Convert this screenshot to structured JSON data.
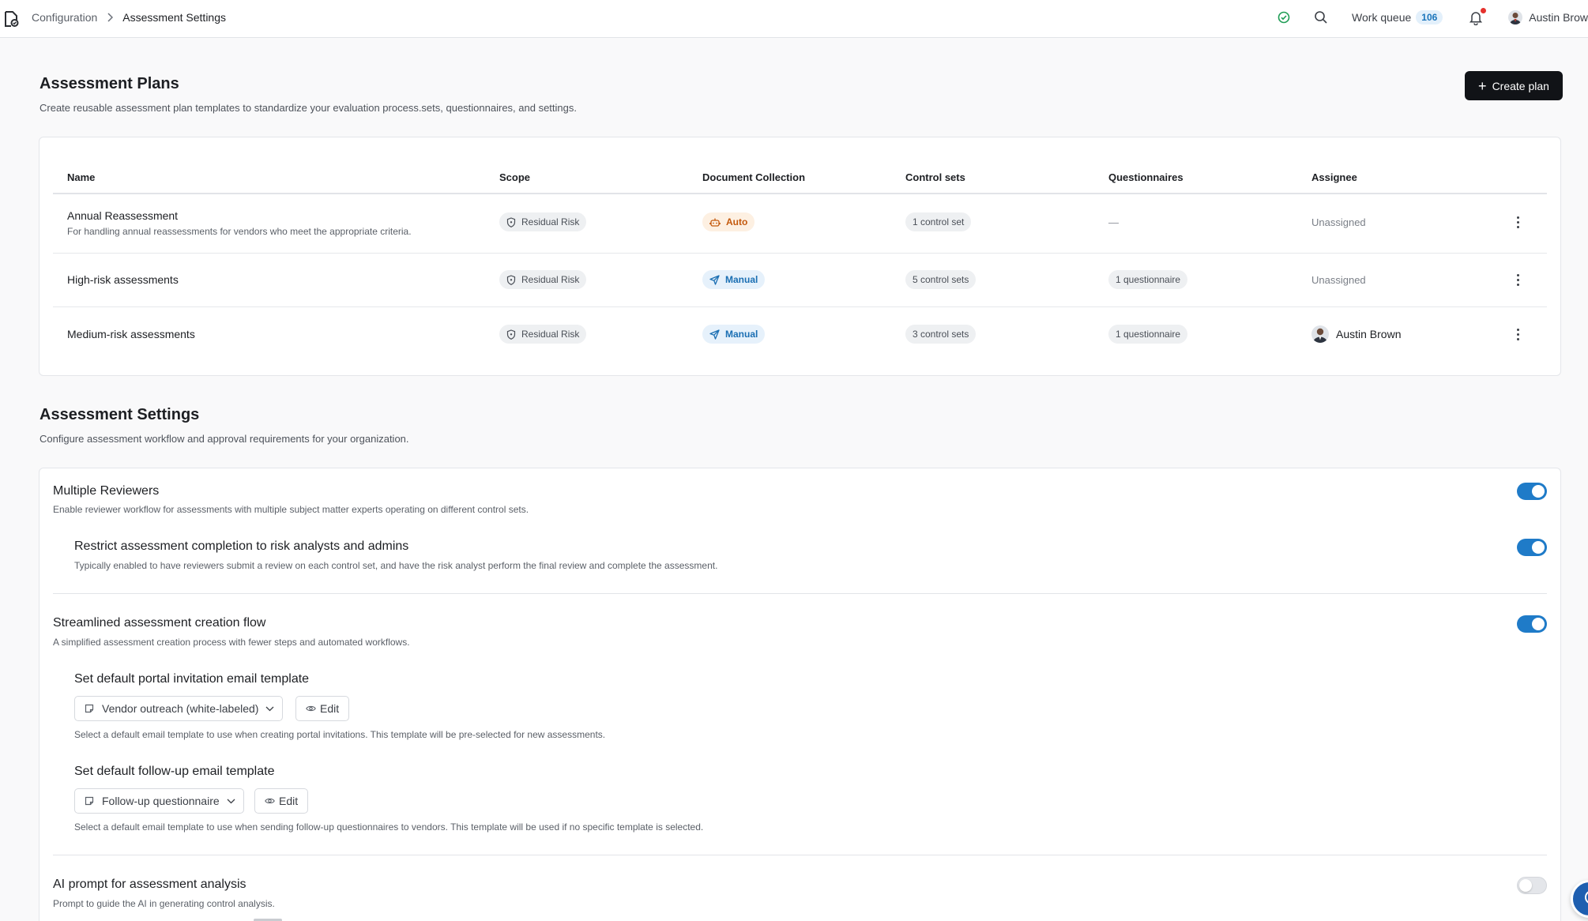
{
  "topbar": {
    "breadcrumb": [
      "Configuration",
      "Assessment Settings"
    ],
    "work_queue_label": "Work queue",
    "work_queue_count": "106",
    "user_name": "Austin Brow",
    "status_color": "#1f9d55",
    "notification_dot_color": "#e5322d"
  },
  "plans": {
    "title": "Assessment Plans",
    "description": "Create reusable assessment plan templates to standardize your evaluation process.sets, questionnaires, and settings.",
    "create_button": "Create plan",
    "columns": [
      "Name",
      "Scope",
      "Document Collection",
      "Control sets",
      "Questionnaires",
      "Assignee"
    ],
    "rows": [
      {
        "name": "Annual Reassessment",
        "description": "For handling annual reassessments for vendors who meet the appropriate criteria.",
        "scope": "Residual Risk",
        "collection": "Auto",
        "collection_icon": "robot-icon",
        "control_sets": "1 control set",
        "questionnaires": "—",
        "assignee": "Unassigned"
      },
      {
        "name": "High-risk assessments",
        "description": "",
        "scope": "Residual Risk",
        "collection": "Manual",
        "collection_icon": "send-icon",
        "control_sets": "5 control sets",
        "questionnaires": "1 questionnaire",
        "assignee": "Unassigned"
      },
      {
        "name": "Medium-risk assessments",
        "description": "",
        "scope": "Residual Risk",
        "collection": "Manual",
        "collection_icon": "send-icon",
        "control_sets": "3 control sets",
        "questionnaires": "1 questionnaire",
        "assignee": "Austin Brown"
      }
    ]
  },
  "settings": {
    "title": "Assessment Settings",
    "description": "Configure assessment workflow and approval requirements for your organization.",
    "multiple_reviewers": {
      "title": "Multiple Reviewers",
      "description": "Enable reviewer workflow for assessments with multiple subject matter experts operating on different control sets.",
      "enabled": true
    },
    "restrict_completion": {
      "title": "Restrict assessment completion to risk analysts and admins",
      "description": "Typically enabled to have reviewers submit a review on each control set, and have the risk analyst perform the final review and complete the assessment.",
      "enabled": true
    },
    "streamlined": {
      "title": "Streamlined assessment creation flow",
      "description": "A simplified assessment creation process with fewer steps and automated workflows.",
      "enabled": true
    },
    "portal_template": {
      "title": "Set default portal invitation email template",
      "selected": "Vendor outreach (white-labeled)",
      "edit_label": "Edit",
      "help": "Select a default email template to use when creating portal invitations. This template will be pre-selected for new assessments."
    },
    "followup_template": {
      "title": "Set default follow-up email template",
      "selected": "Follow-up questionnaire",
      "edit_label": "Edit",
      "help": "Select a default email template to use when sending follow-up questionnaires to vendors. This template will be used if no specific template is selected."
    },
    "ai_prompt": {
      "title": "AI prompt for assessment analysis",
      "description": "Prompt to guide the AI in generating control analysis.",
      "enabled": false
    }
  },
  "colors": {
    "primary_button": "#111317",
    "toggle_on": "#1f7bc8",
    "auto_pill": "#c4590d",
    "manual_pill": "#1b6fb3"
  }
}
